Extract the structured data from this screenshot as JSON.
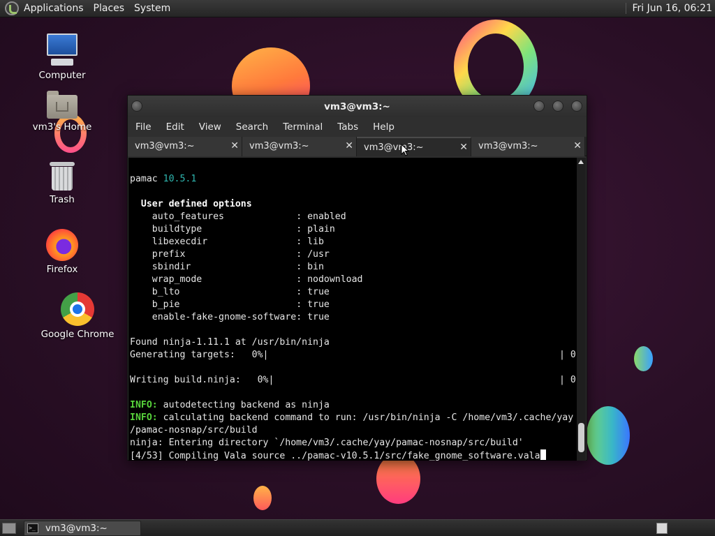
{
  "top_panel": {
    "menus": [
      "Applications",
      "Places",
      "System"
    ],
    "clock": "Fri Jun 16, 06:21"
  },
  "desktop": {
    "icons": [
      {
        "label": "Computer",
        "icon": "computer-icon"
      },
      {
        "label": "vm3's Home",
        "icon": "home-folder-icon"
      },
      {
        "label": "Trash",
        "icon": "trash-icon"
      },
      {
        "label": "Firefox",
        "icon": "firefox-icon"
      },
      {
        "label": "Google Chrome",
        "icon": "chrome-icon"
      }
    ]
  },
  "window": {
    "title": "vm3@vm3:~",
    "menu": [
      "File",
      "Edit",
      "View",
      "Search",
      "Terminal",
      "Tabs",
      "Help"
    ],
    "tabs": [
      {
        "label": "vm3@vm3:~",
        "active": false
      },
      {
        "label": "vm3@vm3:~",
        "active": false
      },
      {
        "label": "vm3@vm3:~",
        "active": true
      },
      {
        "label": "vm3@vm3:~",
        "active": false
      }
    ],
    "terminal": {
      "pamac_name": "pamac",
      "pamac_version": "10.5.1",
      "options_heading": "User defined options",
      "options": [
        {
          "key": "auto_features",
          "value": "enabled"
        },
        {
          "key": "buildtype",
          "value": "plain"
        },
        {
          "key": "libexecdir",
          "value": "lib"
        },
        {
          "key": "prefix",
          "value": "/usr"
        },
        {
          "key": "sbindir",
          "value": "bin"
        },
        {
          "key": "wrap_mode",
          "value": "nodownload"
        },
        {
          "key": "b_lto",
          "value": "true"
        },
        {
          "key": "b_pie",
          "value": "true"
        },
        {
          "key": "enable-fake-gnome-software",
          "value": "true"
        }
      ],
      "found_ninja": "Found ninja-1.11.1 at /usr/bin/ninja",
      "generating_targets": "Generating targets:   0%|",
      "generating_count": "| 0",
      "writing_build": "Writing build.ninja:   0%|",
      "writing_count": "| 0",
      "info_label": "INFO:",
      "info_1": " autodetecting backend as ninja",
      "info_2": " calculating backend command to run: /usr/bin/ninja -C /home/vm3/.cache/yay",
      "info_2_cont": "/pamac-nosnap/src/build",
      "ninja_enter": "ninja: Entering directory `/home/vm3/.cache/yay/pamac-nosnap/src/build'",
      "compiling": "[4/53] Compiling Vala source ../pamac-v10.5.1/src/fake_gnome_software.vala"
    }
  },
  "bottom_panel": {
    "task_label": "vm3@vm3:~"
  }
}
